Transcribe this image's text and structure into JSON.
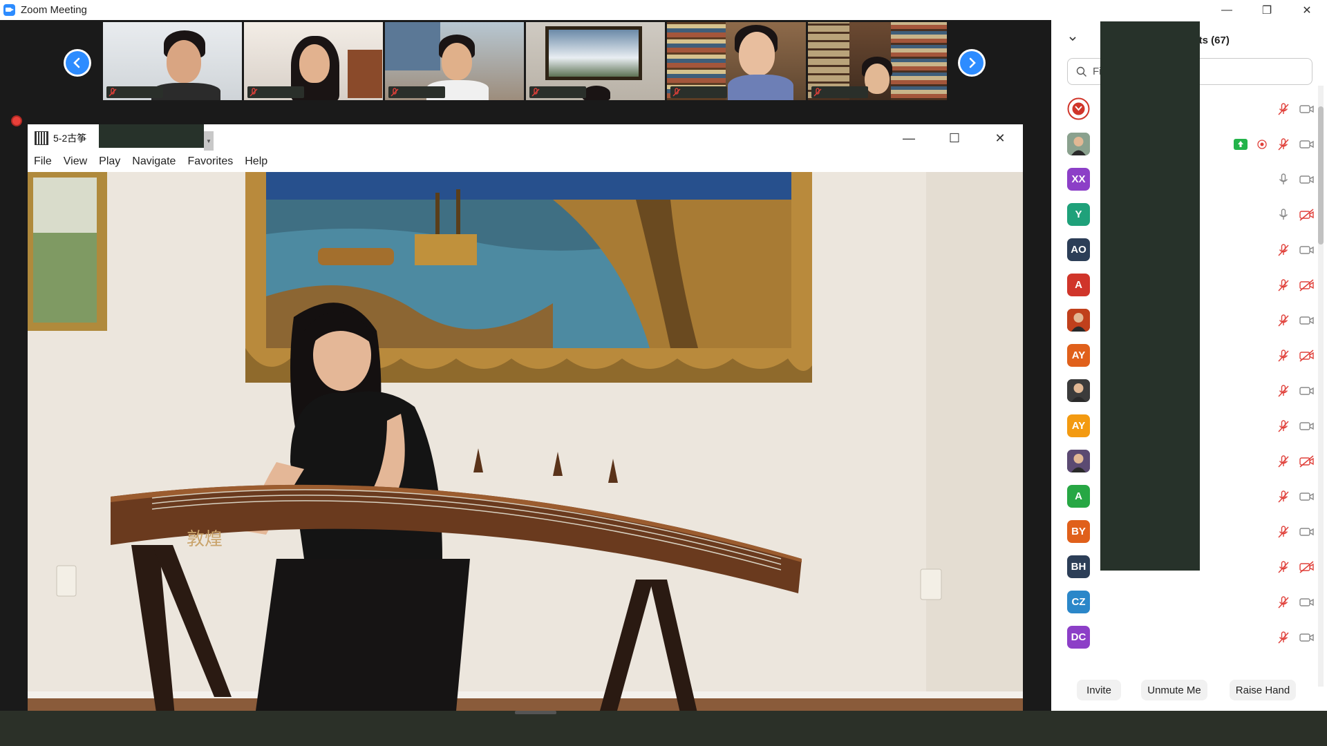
{
  "window": {
    "title": "Zoom Meeting",
    "minimize_glyph": "—",
    "restore_glyph": "❐",
    "close_glyph": "✕"
  },
  "gallery": {
    "prev_icon": "chevron-left-icon",
    "next_icon": "chevron-right-icon",
    "tiles": [
      {
        "label": "",
        "muted": true
      },
      {
        "label": "",
        "muted": true
      },
      {
        "label": "",
        "muted": true
      },
      {
        "label": "",
        "muted": true
      },
      {
        "label": "",
        "muted": true
      },
      {
        "label": "",
        "muted": true
      }
    ]
  },
  "player": {
    "file_title": "5-2古筝",
    "minimize_glyph": "—",
    "maximize_glyph": "☐",
    "close_glyph": "✕",
    "menu": [
      "File",
      "View",
      "Play",
      "Navigate",
      "Favorites",
      "Help"
    ],
    "instrument_logo_text": "敦煌"
  },
  "participants": {
    "title": "Participants (67)",
    "search_placeholder": "Find a participant",
    "rows": [
      {
        "initials": "",
        "avatar_color": "#ffffff",
        "avatar_kind": "logo",
        "mic": "muted",
        "video": "on"
      },
      {
        "initials": "",
        "avatar_color": "#8aa18e",
        "avatar_kind": "photo",
        "mic": "muted",
        "video": "on",
        "sharing": true,
        "recording": true
      },
      {
        "initials": "XX",
        "avatar_color": "#8c3fc7",
        "avatar_kind": "initials",
        "mic": "on",
        "video": "on"
      },
      {
        "initials": "Y",
        "avatar_color": "#1fa17a",
        "avatar_kind": "initials",
        "mic": "on",
        "video": "off"
      },
      {
        "initials": "AO",
        "avatar_color": "#2c3e57",
        "avatar_kind": "initials",
        "mic": "muted",
        "video": "on"
      },
      {
        "initials": "A",
        "avatar_color": "#d0352a",
        "avatar_kind": "initials",
        "mic": "muted",
        "video": "off"
      },
      {
        "initials": "",
        "avatar_color": "#c0401c",
        "avatar_kind": "photo",
        "mic": "muted",
        "video": "on"
      },
      {
        "initials": "AY",
        "avatar_color": "#e0601b",
        "avatar_kind": "initials",
        "mic": "muted",
        "video": "off"
      },
      {
        "initials": "",
        "avatar_color": "#3b3b3b",
        "avatar_kind": "photo",
        "mic": "muted",
        "video": "on"
      },
      {
        "initials": "AY",
        "avatar_color": "#f39a11",
        "avatar_kind": "initials",
        "mic": "muted",
        "video": "on"
      },
      {
        "initials": "",
        "avatar_color": "#5b4a72",
        "avatar_kind": "photo",
        "mic": "muted",
        "video": "off"
      },
      {
        "initials": "A",
        "avatar_color": "#27a744",
        "avatar_kind": "initials",
        "mic": "muted",
        "video": "on"
      },
      {
        "initials": "BY",
        "avatar_color": "#e0601b",
        "avatar_kind": "initials",
        "mic": "muted",
        "video": "on"
      },
      {
        "initials": "BH",
        "avatar_color": "#2c3e57",
        "avatar_kind": "initials",
        "mic": "muted",
        "video": "off"
      },
      {
        "initials": "CZ",
        "avatar_color": "#2b87c9",
        "avatar_kind": "initials",
        "mic": "muted",
        "video": "on"
      },
      {
        "initials": "DC",
        "avatar_color": "#8c3fc7",
        "avatar_kind": "initials",
        "mic": "muted",
        "video": "on"
      },
      {
        "initials": "",
        "avatar_color": "#27a744",
        "avatar_kind": "initials",
        "mic": "muted",
        "video": "on"
      }
    ],
    "invite_label": "Invite",
    "unmute_label": "Unmute Me",
    "raise_hand_label": "Raise Hand"
  }
}
